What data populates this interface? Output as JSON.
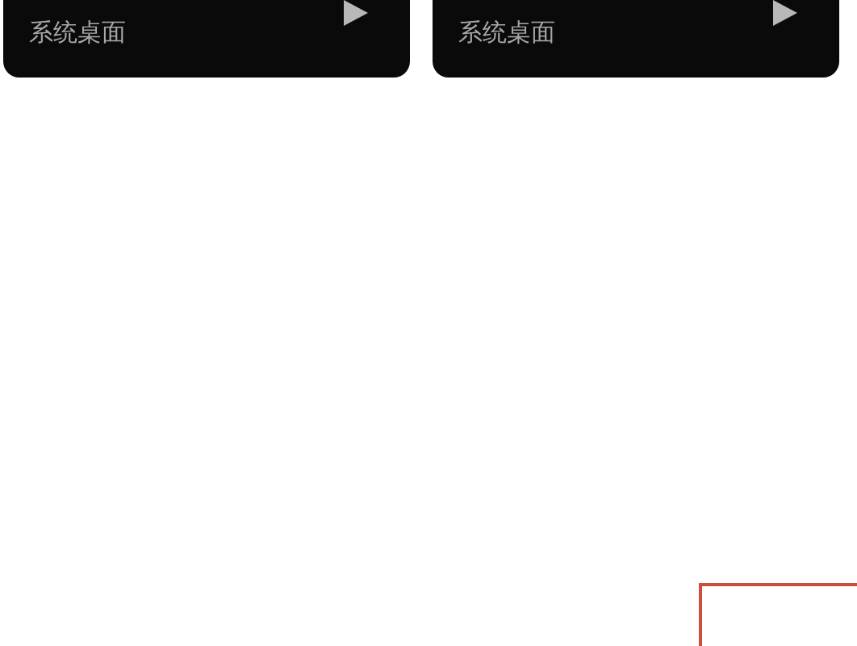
{
  "recordings": [
    {
      "source": "系统桌面"
    },
    {
      "source": "系统桌面"
    }
  ]
}
